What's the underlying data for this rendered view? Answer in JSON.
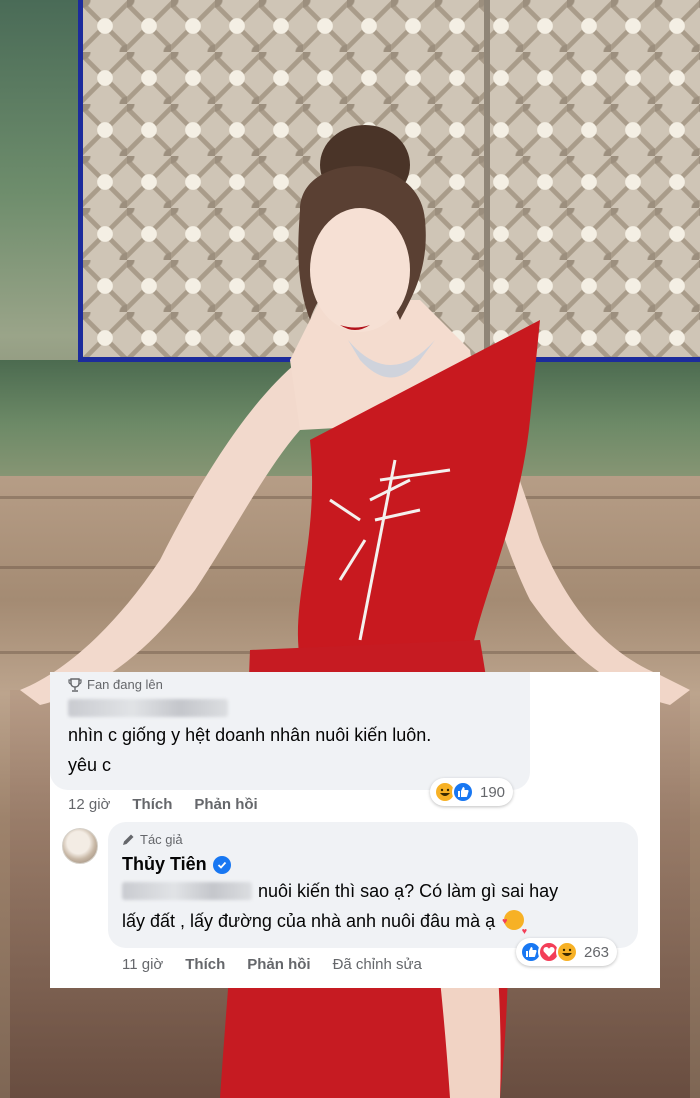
{
  "comments": [
    {
      "badge": "Fan đang lên",
      "author_hidden": true,
      "text_line1": "nhìn c giống y hệt doanh nhân nuôi kiến luôn.",
      "text_line2": "yêu c",
      "time": "12 giờ",
      "like_label": "Thích",
      "reply_label": "Phản hồi",
      "reaction_icons": [
        "haha-icon",
        "like-icon"
      ],
      "reaction_count": "190"
    },
    {
      "badge": "Tác giả",
      "author": "Thủy Tiên",
      "verified": true,
      "mention_hidden": true,
      "text_line1": "nuôi kiến thì sao ạ? Có làm gì sai hay",
      "text_line2": "lấy đất , lấy đường của nhà anh nuôi đâu mà ạ",
      "time": "11 giờ",
      "like_label": "Thích",
      "reply_label": "Phản hồi",
      "edited_label": "Đã chỉnh sửa",
      "reaction_icons": [
        "like-icon",
        "love-icon",
        "haha-icon"
      ],
      "reaction_count": "263"
    }
  ],
  "colors": {
    "facebook_blue": "#1877f2",
    "love_red": "#f33e58",
    "haha_yellow": "#f7b125",
    "dress_red": "#c8191f",
    "bubble_gray": "#f0f2f5"
  }
}
